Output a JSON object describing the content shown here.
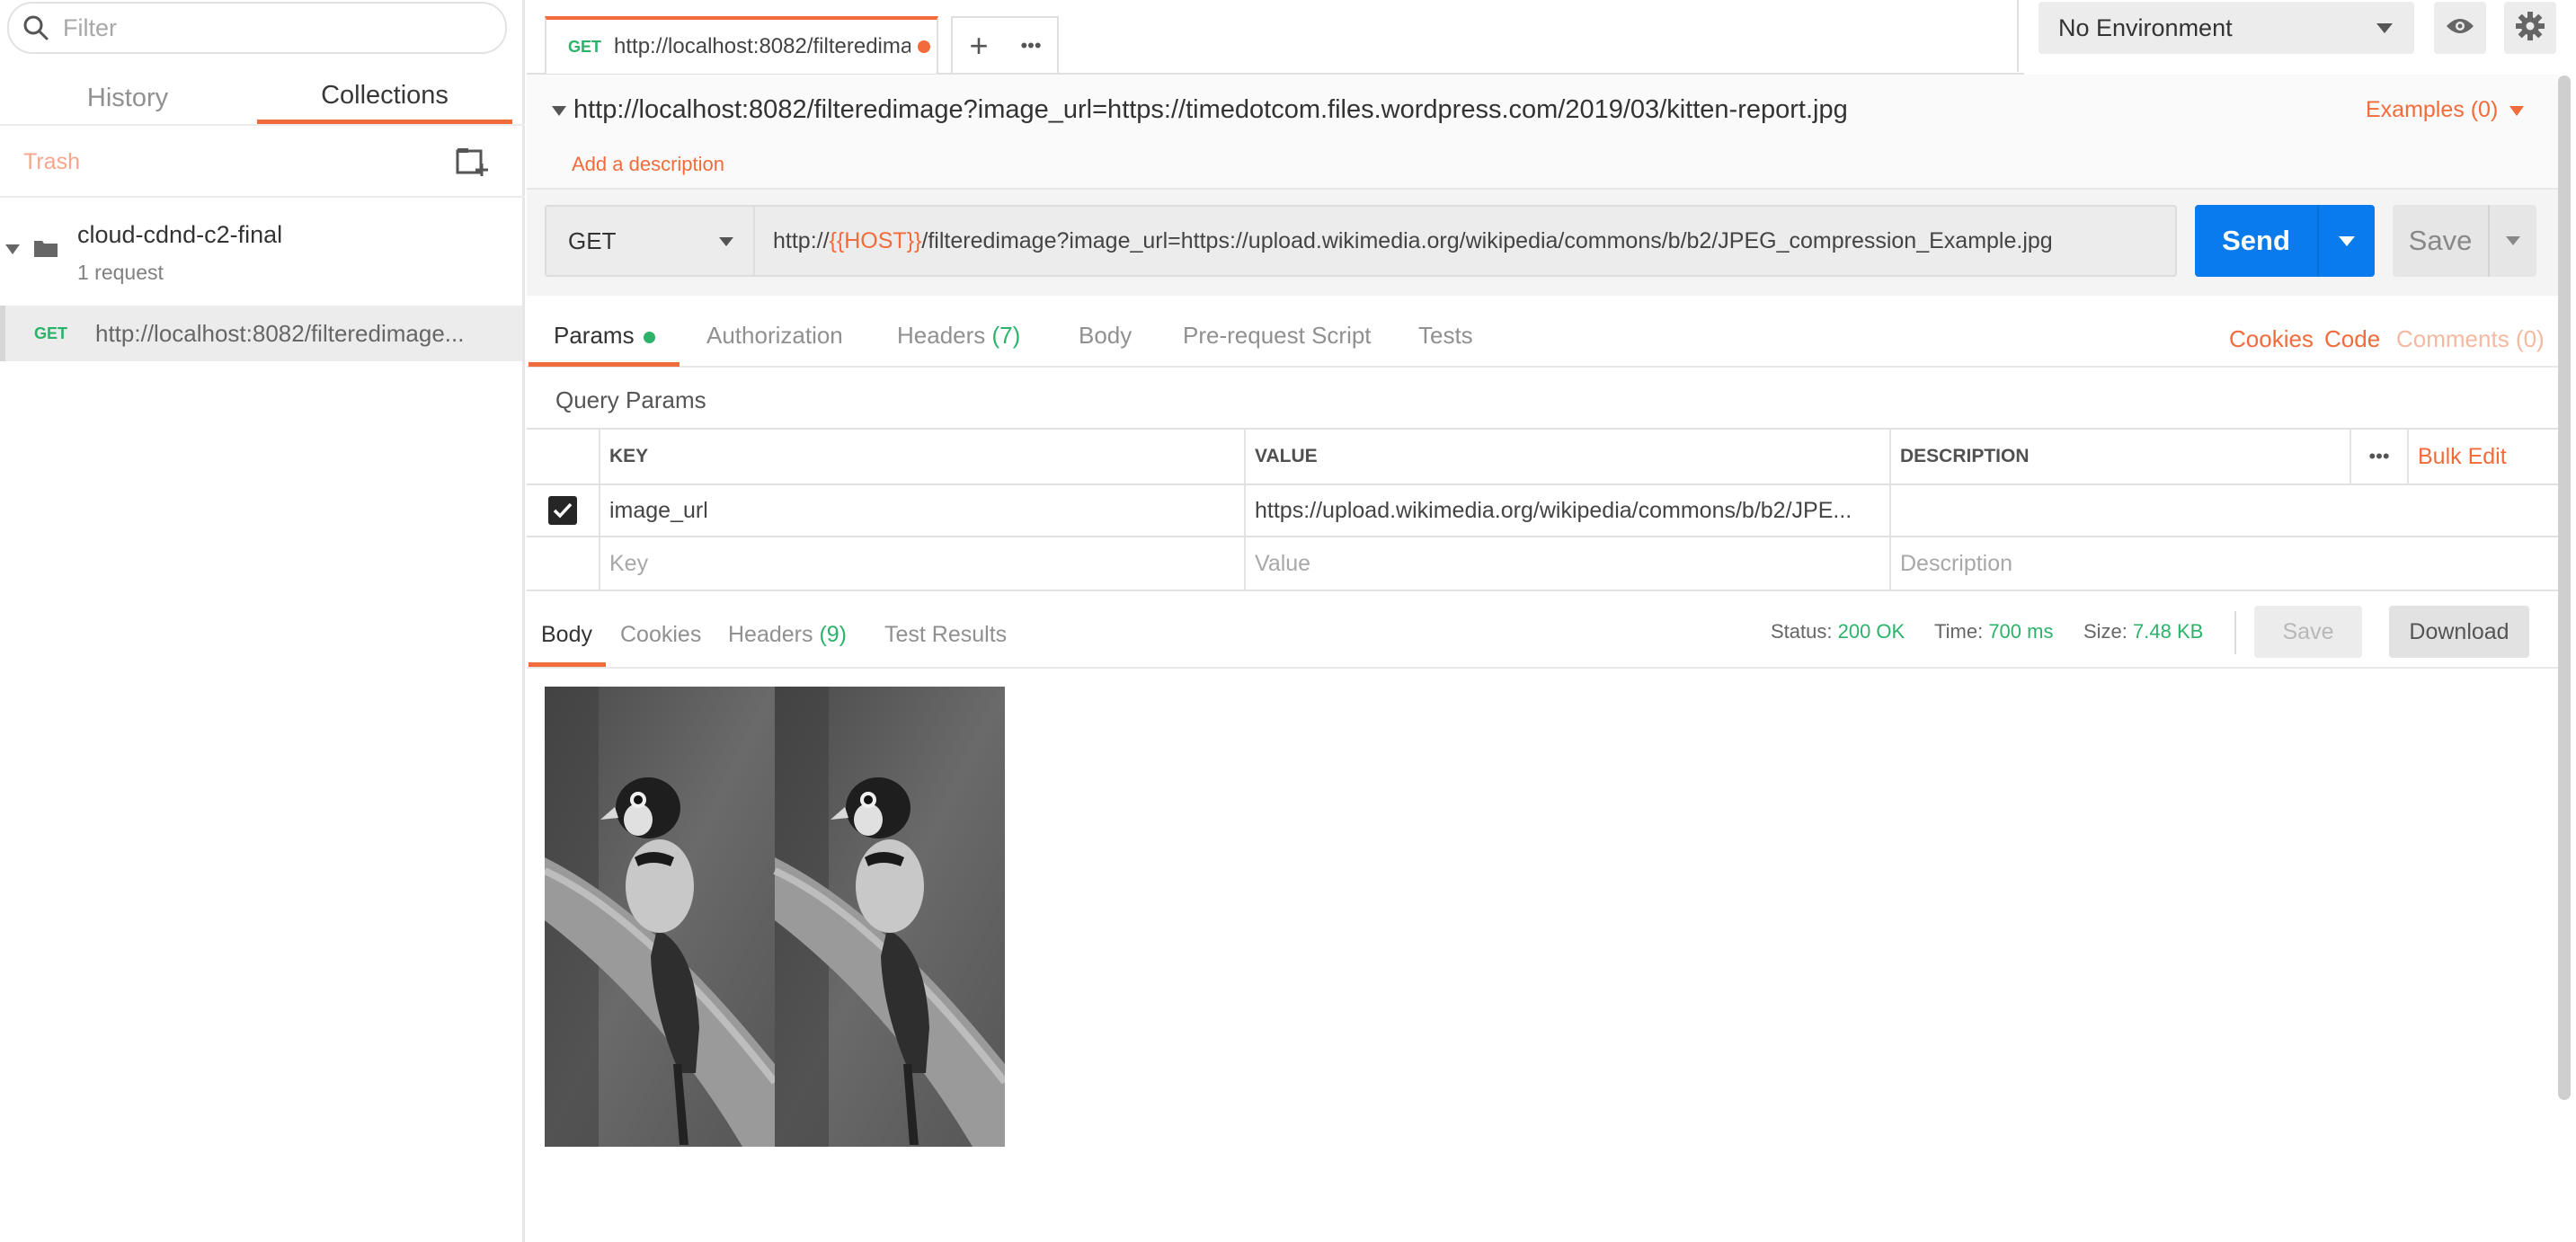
{
  "sidebar": {
    "filter_placeholder": "Filter",
    "tabs": [
      {
        "label": "History"
      },
      {
        "label": "Collections"
      }
    ],
    "trash_label": "Trash",
    "collection": {
      "name": "cloud-cdnd-c2-final",
      "count": "1 request"
    },
    "request": {
      "method": "GET",
      "url": "http://localhost:8082/filteredimage..."
    }
  },
  "tabbar": {
    "tab_method": "GET",
    "tab_label": "http://localhost:8082/filteredima",
    "add_glyph": "+",
    "more_glyph": "•••"
  },
  "environment": {
    "selected": "No Environment"
  },
  "request": {
    "title": "http://localhost:8082/filteredimage?image_url=https://timedotcom.files.wordpress.com/2019/03/kitten-report.jpg",
    "examples": "Examples (0)",
    "add_description": "Add a description",
    "method": "GET",
    "url_prefix": "http://",
    "url_var": "{{HOST}}",
    "url_suffix": "/filteredimage?image_url=https://upload.wikimedia.org/wikipedia/commons/b/b2/JPEG_compression_Example.jpg",
    "send_label": "Send",
    "save_label": "Save"
  },
  "request_tabs": {
    "params": "Params",
    "authorization": "Authorization",
    "headers": "Headers",
    "headers_count": "(7)",
    "body": "Body",
    "prerequest": "Pre-request Script",
    "tests": "Tests",
    "cookies": "Cookies",
    "code": "Code",
    "comments": "Comments (0)"
  },
  "query_params": {
    "title": "Query Params",
    "headers": {
      "key": "KEY",
      "value": "VALUE",
      "description": "DESCRIPTION"
    },
    "more_glyph": "•••",
    "bulk_edit": "Bulk Edit",
    "rows": [
      {
        "key": "image_url",
        "value": "https://upload.wikimedia.org/wikipedia/commons/b/b2/JPE...",
        "description": ""
      }
    ],
    "placeholders": {
      "key": "Key",
      "value": "Value",
      "description": "Description"
    }
  },
  "response": {
    "tabs": {
      "body": "Body",
      "cookies": "Cookies",
      "headers": "Headers",
      "headers_count": "(9)",
      "test_results": "Test Results"
    },
    "status_label": "Status:",
    "status_value": "200 OK",
    "time_label": "Time:",
    "time_value": "700 ms",
    "size_label": "Size:",
    "size_value": "7.48 KB",
    "save_label": "Save",
    "download_label": "Download"
  },
  "colors": {
    "accent": "#f26b3a",
    "send_blue": "#097bed",
    "success_green": "#2cb36a"
  }
}
